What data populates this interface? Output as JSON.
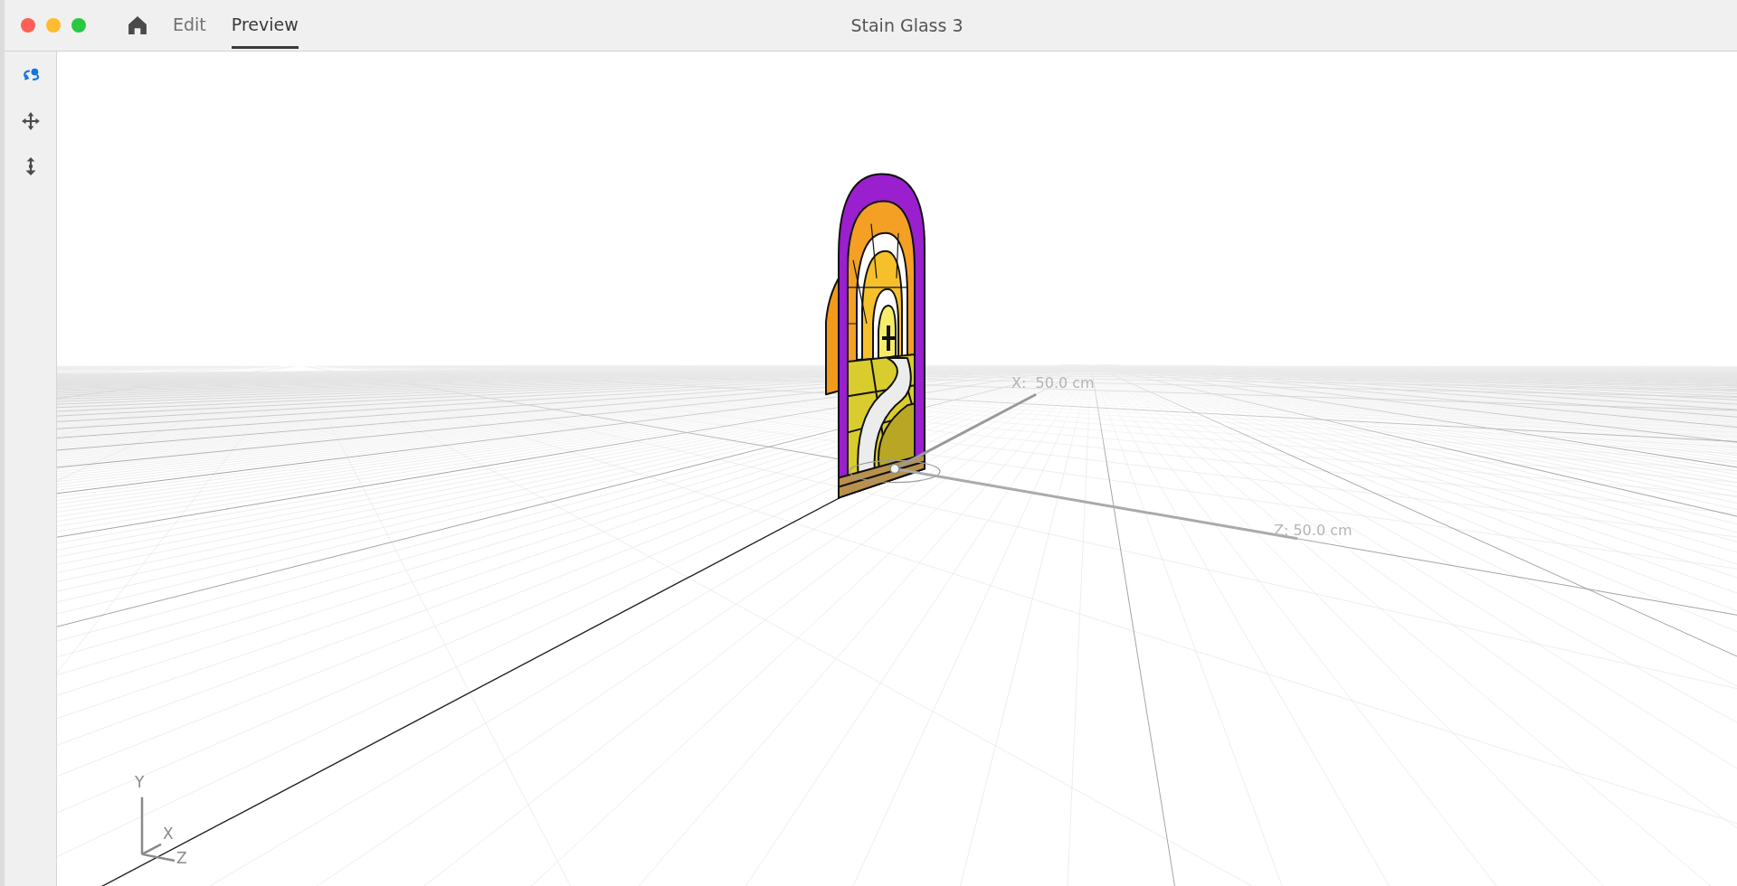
{
  "window": {
    "title": "Stain Glass 3"
  },
  "tabs": [
    {
      "label": "Edit",
      "selected": false
    },
    {
      "label": "Preview",
      "selected": true
    }
  ],
  "tools": [
    {
      "kind": "orbit",
      "selected": true
    },
    {
      "kind": "move",
      "selected": false
    },
    {
      "kind": "vertical",
      "selected": false
    }
  ],
  "viewport": {
    "x_label": "X:  50.0 cm",
    "z_label": "Z: 50.0 cm",
    "gizmo": {
      "y": "Y",
      "x": "X",
      "z": "Z"
    }
  }
}
